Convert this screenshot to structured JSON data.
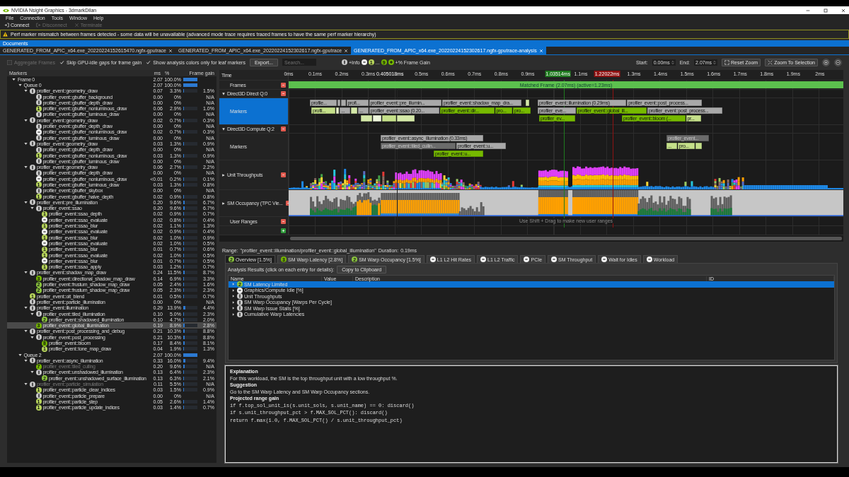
{
  "window": {
    "title": "NVIDIA Nsight Graphics - 3dmarkDilan"
  },
  "menu": [
    "File",
    "Connection",
    "Tools",
    "Window",
    "Help"
  ],
  "toolbar": [
    {
      "kind": "connect",
      "label": "Connect",
      "disabled": false
    },
    {
      "kind": "disconnect",
      "label": "Disconnect",
      "disabled": true
    },
    {
      "kind": "terminate",
      "label": "Terminate",
      "disabled": true
    }
  ],
  "warning": "Perf marker mismatch between frames detected - some data will be unavailable (advanced mode trace requires traced frames to have the same perf marker hierarchy)",
  "documents": {
    "title": "Documents",
    "tabs": [
      {
        "label": "GENERATED_FROM_APIC_x64.exe_20220224152615470.ngfx-gputrace",
        "selected": false
      },
      {
        "label": "GENERATED_FROM_APIC_x64.exe_20220224152302617.ngfx-gputrace",
        "selected": false
      },
      {
        "label": "GENERATED_FROM_APIC_x64.exe_20220224152302617.ngfx-gputrace-analysis",
        "selected": true
      }
    ]
  },
  "options": {
    "checkboxes": [
      {
        "label": "Aggregate Frames",
        "checked": false,
        "disabled": true
      },
      {
        "label": "Skip GPU-idle gaps for frame gain",
        "checked": true,
        "disabled": false
      },
      {
        "label": "Show analysis colors only for leaf markers",
        "checked": true,
        "disabled": false
      }
    ],
    "export": "Export...",
    "search": {
      "placeholder": "Search..."
    },
    "legend": [
      {
        "kind": "info"
      },
      {
        "kind": "text",
        "text": "+Info"
      },
      {
        "kind": "idle"
      },
      {
        "kind": "gain",
        "text": "1",
        "color": "#b8d65c"
      },
      {
        "kind": "text",
        "text": "..."
      },
      {
        "kind": "gain",
        "text": "9",
        "color": "#76b900"
      },
      {
        "kind": "plus"
      },
      {
        "kind": "text",
        "text": "+% Frame Gain"
      }
    ],
    "start_label": "Start:",
    "start": "0.00ms",
    "end_label": "End:",
    "end": "2.07ms",
    "buttons": [
      {
        "kind": "reset",
        "label": "Reset Zoom"
      },
      {
        "kind": "select",
        "label": "Zoom To Selection"
      },
      {
        "kind": "zoom-in"
      },
      {
        "kind": "zoom-out"
      }
    ]
  },
  "markers": {
    "columns": [
      "Markers",
      "ms",
      "%",
      "Frame gain"
    ],
    "rows": [
      {
        "name": "Frame 0",
        "ms": "2.07",
        "pct": "100.0%",
        "level": 1,
        "selected": false,
        "dimmed": false,
        "expanded": true,
        "children": [
          {
            "name": "Queue 0",
            "ms": "2.07",
            "pct": "100.0%",
            "level": 1,
            "selected": false,
            "dimmed": false,
            "expanded": true,
            "children": [
              {
                "name": "profiler_event::geometry_draw",
                "kind": "info",
                "ms": "0.07",
                "pct": "3.3%",
                "level": 0.033,
                "gain": "1.5%",
                "selected": false,
                "dimmed": false,
                "expanded": true,
                "children": [
                  {
                    "name": "profiler_event::gbuffer_background",
                    "kind": "info",
                    "ms": "0.00",
                    "pct": "0%",
                    "gain": "N/A",
                    "selected": false,
                    "dimmed": false
                  },
                  {
                    "name": "profiler_event::gbuffer_depth_draw",
                    "kind": "info",
                    "ms": "0.00",
                    "pct": "0%",
                    "gain": "N/A",
                    "selected": false,
                    "dimmed": false
                  },
                  {
                    "name": "profiler_event::gbuffer_nonluminous_draw",
                    "kind": "gain",
                    "badge": "1",
                    "color": "#b8d65c",
                    "ms": "0.06",
                    "pct": "2.9%",
                    "level": 0.029,
                    "gain": "1.0%",
                    "selected": false,
                    "dimmed": false
                  },
                  {
                    "name": "profiler_event::gbuffer_luminous_draw",
                    "kind": "info",
                    "ms": "0.00",
                    "pct": "0%",
                    "gain": "N/A",
                    "selected": false,
                    "dimmed": false
                  }
                ]
              },
              {
                "name": "profiler_event::geometry_draw",
                "kind": "info",
                "ms": "0.02",
                "pct": "0.7%",
                "level": 0.007,
                "gain": "0.3%",
                "selected": false,
                "dimmed": false,
                "expanded": true,
                "children": [
                  {
                    "name": "profiler_event::gbuffer_depth_draw",
                    "kind": "info",
                    "ms": "0.00",
                    "pct": "0%",
                    "gain": "N/A",
                    "selected": false,
                    "dimmed": false
                  },
                  {
                    "name": "profiler_event::gbuffer_nonluminous_draw",
                    "kind": "idle",
                    "ms": "0.02",
                    "pct": "0.7%",
                    "level": 0.007,
                    "gain": "0.3%",
                    "selected": false,
                    "dimmed": false
                  },
                  {
                    "name": "profiler_event::gbuffer_luminous_draw",
                    "kind": "info",
                    "ms": "0.00",
                    "pct": "0%",
                    "gain": "N/A",
                    "selected": false,
                    "dimmed": false
                  }
                ]
              },
              {
                "name": "profiler_event::geometry_draw",
                "kind": "info",
                "ms": "0.03",
                "pct": "1.3%",
                "level": 0.013,
                "gain": "0.9%",
                "selected": false,
                "dimmed": false,
                "expanded": true,
                "children": [
                  {
                    "name": "profiler_event::gbuffer_depth_draw",
                    "kind": "info",
                    "ms": "0.00",
                    "pct": "0%",
                    "gain": "N/A",
                    "selected": false,
                    "dimmed": false
                  },
                  {
                    "name": "profiler_event::gbuffer_nonluminous_draw",
                    "kind": "gain",
                    "badge": "1",
                    "color": "#b8d65c",
                    "ms": "0.03",
                    "pct": "1.3%",
                    "level": 0.013,
                    "gain": "0.9%",
                    "selected": false,
                    "dimmed": false
                  },
                  {
                    "name": "profiler_event::gbuffer_luminous_draw",
                    "kind": "info",
                    "ms": "0.00",
                    "pct": "0%",
                    "gain": "N/A",
                    "selected": false,
                    "dimmed": false
                  }
                ]
              },
              {
                "name": "profiler_event::geometry_draw",
                "kind": "info",
                "ms": "0.06",
                "pct": "2.7%",
                "level": 0.027,
                "gain": "2.2%",
                "selected": false,
                "dimmed": false,
                "expanded": true,
                "children": [
                  {
                    "name": "profiler_event::gbuffer_depth_draw",
                    "kind": "info",
                    "ms": "0.00",
                    "pct": "0%",
                    "gain": "N/A",
                    "selected": false,
                    "dimmed": false
                  },
                  {
                    "name": "profiler_event::gbuffer_nonluminous_draw",
                    "kind": "idle",
                    "ms": "<0.01",
                    "pct": "0.2%",
                    "level": 0.002,
                    "gain": "0.1%",
                    "selected": false,
                    "dimmed": false
                  },
                  {
                    "name": "profiler_event::gbuffer_luminous_draw",
                    "kind": "gain",
                    "badge": "1",
                    "color": "#b8d65c",
                    "ms": "0.03",
                    "pct": "1.3%",
                    "level": 0.013,
                    "gain": "0.8%",
                    "selected": false,
                    "dimmed": false
                  },
                  {
                    "name": "profiler_event::gbuffer_skybox",
                    "kind": "info",
                    "ms": "0.00",
                    "pct": "0%",
                    "gain": "N/A",
                    "selected": false,
                    "dimmed": false
                  },
                  {
                    "name": "profiler_event::gbuffer_halve_depth",
                    "kind": "gain",
                    "badge": "1",
                    "color": "#b8d65c",
                    "ms": "0.02",
                    "pct": "0.9%",
                    "level": 0.009,
                    "gain": "0.8%",
                    "selected": false,
                    "dimmed": false
                  }
                ]
              },
              {
                "name": "profiler_event::pre_illumination",
                "kind": "info",
                "ms": "0.20",
                "pct": "9.6%",
                "level": 0.096,
                "gain": "6.7%",
                "selected": false,
                "dimmed": false,
                "expanded": true,
                "children": [
                  {
                    "name": "profiler_event::ssao",
                    "kind": "info",
                    "ms": "0.20",
                    "pct": "9.6%",
                    "level": 0.096,
                    "gain": "6.7%",
                    "selected": false,
                    "dimmed": false,
                    "expanded": true,
                    "children": [
                      {
                        "name": "profiler_event::ssao_depth",
                        "kind": "gain",
                        "badge": "1",
                        "color": "#b8d65c",
                        "ms": "0.02",
                        "pct": "0.9%",
                        "level": 0.009,
                        "gain": "0.7%",
                        "selected": false,
                        "dimmed": false
                      },
                      {
                        "name": "profiler_event::ssao_evaluate",
                        "kind": "idle",
                        "ms": "0.02",
                        "pct": "0.8%",
                        "level": 0.008,
                        "gain": "0.4%",
                        "selected": false,
                        "dimmed": false
                      },
                      {
                        "name": "profiler_event::ssao_blur",
                        "kind": "gain",
                        "badge": "1",
                        "color": "#b8d65c",
                        "ms": "0.02",
                        "pct": "1.1%",
                        "level": 0.011,
                        "gain": "1.3%",
                        "selected": false,
                        "dimmed": false
                      },
                      {
                        "name": "profiler_event::ssao_evaluate",
                        "kind": "idle",
                        "ms": "0.02",
                        "pct": "0.9%",
                        "level": 0.009,
                        "gain": "0.4%",
                        "selected": false,
                        "dimmed": false
                      },
                      {
                        "name": "profiler_event::ssao_blur",
                        "kind": "gain",
                        "badge": "1",
                        "color": "#b8d65c",
                        "ms": "0.02",
                        "pct": "1.0%",
                        "level": 0.01,
                        "gain": "0.9%",
                        "selected": false,
                        "dimmed": false
                      },
                      {
                        "name": "profiler_event::ssao_evaluate",
                        "kind": "idle",
                        "ms": "0.02",
                        "pct": "1.0%",
                        "level": 0.01,
                        "gain": "0.5%",
                        "selected": false,
                        "dimmed": false
                      },
                      {
                        "name": "profiler_event::ssao_blur",
                        "kind": "gain",
                        "badge": "1",
                        "color": "#b8d65c",
                        "ms": "0.01",
                        "pct": "0.7%",
                        "level": 0.007,
                        "gain": "0.6%",
                        "selected": false,
                        "dimmed": false
                      },
                      {
                        "name": "profiler_event::ssao_evaluate",
                        "kind": "gain",
                        "badge": "1",
                        "color": "#b8d65c",
                        "ms": "0.02",
                        "pct": "1.0%",
                        "level": 0.01,
                        "gain": "0.5%",
                        "selected": false,
                        "dimmed": false
                      },
                      {
                        "name": "profiler_event::ssao_blur",
                        "kind": "idle",
                        "ms": "0.01",
                        "pct": "0.7%",
                        "level": 0.007,
                        "gain": "0.5%",
                        "selected": false,
                        "dimmed": false
                      },
                      {
                        "name": "profiler_event::ssao_apply",
                        "kind": "gain",
                        "badge": "1",
                        "color": "#b8d65c",
                        "ms": "0.03",
                        "pct": "1.2%",
                        "level": 0.012,
                        "gain": "0.7%",
                        "selected": false,
                        "dimmed": false
                      }
                    ]
                  }
                ]
              },
              {
                "name": "profiler_event::shadow_map_draw",
                "kind": "info",
                "ms": "0.24",
                "pct": "11.5%",
                "level": 0.115,
                "gain": "8.7%",
                "selected": false,
                "dimmed": false,
                "expanded": true,
                "children": [
                  {
                    "name": "profiler_event::directional_shadow_map_draw",
                    "kind": "gain",
                    "badge": "3",
                    "color": "#76b900",
                    "ms": "0.14",
                    "pct": "6.9%",
                    "level": 0.069,
                    "gain": "3.3%",
                    "selected": false,
                    "dimmed": false
                  },
                  {
                    "name": "profiler_event::frustum_shadow_map_draw",
                    "kind": "gain",
                    "badge": "2",
                    "color": "#8cc63f",
                    "ms": "0.05",
                    "pct": "2.4%",
                    "level": 0.024,
                    "gain": "1.6%",
                    "selected": false,
                    "dimmed": false
                  },
                  {
                    "name": "profiler_event::frustum_shadow_map_draw",
                    "kind": "gain",
                    "badge": "2",
                    "color": "#8cc63f",
                    "ms": "0.05",
                    "pct": "2.3%",
                    "level": 0.023,
                    "gain": "2.3%",
                    "selected": false,
                    "dimmed": false
                  }
                ]
              },
              {
                "name": "profiler_event::oit_blend",
                "kind": "gain",
                "badge": "1",
                "color": "#b8d65c",
                "ms": "0.01",
                "pct": "0.5%",
                "level": 0.005,
                "gain": "0.7%",
                "selected": false,
                "dimmed": false
              },
              {
                "name": "profiler_event::particle_illumination",
                "kind": "info",
                "ms": "0.00",
                "pct": "0%",
                "gain": "N/A",
                "selected": false,
                "dimmed": false
              },
              {
                "name": "profiler_event::illumination",
                "kind": "info",
                "ms": "0.29",
                "pct": "13.9%",
                "level": 0.139,
                "gain": "4.4%",
                "selected": false,
                "dimmed": false,
                "expanded": true,
                "children": [
                  {
                    "name": "profiler_event::tiled_illumination",
                    "kind": "info",
                    "ms": "0.10",
                    "pct": "5.0%",
                    "level": 0.05,
                    "gain": "2.3%",
                    "selected": false,
                    "dimmed": false,
                    "expanded": true,
                    "children": [
                      {
                        "name": "profiler_event::shadowed_illumination",
                        "kind": "gain",
                        "badge": "2",
                        "color": "#8cc63f",
                        "ms": "0.10",
                        "pct": "4.7%",
                        "level": 0.047,
                        "gain": "2.0%",
                        "selected": false,
                        "dimmed": false
                      }
                    ]
                  },
                  {
                    "name": "profiler_event::global_illumination",
                    "kind": "gain",
                    "badge": "3",
                    "color": "#76b900",
                    "ms": "0.19",
                    "pct": "8.9%",
                    "level": 0.089,
                    "gain": "2.8%",
                    "selected": true,
                    "dimmed": false
                  }
                ]
              },
              {
                "name": "profiler_event::post_processing_and_debug",
                "kind": "info",
                "ms": "0.21",
                "pct": "10.3%",
                "level": 0.103,
                "gain": "8.8%",
                "selected": false,
                "dimmed": false,
                "expanded": true,
                "children": [
                  {
                    "name": "profiler_event::post_processing",
                    "kind": "info",
                    "ms": "0.21",
                    "pct": "10.3%",
                    "level": 0.103,
                    "gain": "8.8%",
                    "selected": false,
                    "dimmed": false,
                    "expanded": true,
                    "children": [
                      {
                        "name": "profiler_event::bloom",
                        "kind": "gain",
                        "badge": "8",
                        "color": "#76b900",
                        "ms": "0.17",
                        "pct": "8.4%",
                        "level": 0.084,
                        "gain": "8.1%",
                        "selected": false,
                        "dimmed": false
                      },
                      {
                        "name": "profiler_event::tone_map_draw",
                        "kind": "gain",
                        "badge": "1",
                        "color": "#b8d65c",
                        "ms": "0.04",
                        "pct": "1.9%",
                        "level": 0.019,
                        "gain": "1.3%",
                        "selected": false,
                        "dimmed": false
                      }
                    ]
                  }
                ]
              }
            ]
          },
          {
            "name": "Queue 2",
            "ms": "2.07",
            "pct": "100.0%",
            "level": 1,
            "selected": false,
            "dimmed": false,
            "expanded": true,
            "children": [
              {
                "name": "profiler_event::async_illumination",
                "kind": "info",
                "ms": "0.33",
                "pct": "16.0%",
                "level": 0.16,
                "gain": "9.4%",
                "selected": false,
                "dimmed": false,
                "expanded": true,
                "children": [
                  {
                    "name": "profiler_event::tiled_culling",
                    "kind": "gain",
                    "badge": "7",
                    "color": "#76b900",
                    "ms": "0.20",
                    "pct": "9.6%",
                    "level": 0.096,
                    "gain": "N/A",
                    "selected": false,
                    "dimmed": true
                  },
                  {
                    "name": "profiler_event::unshadowed_illumination",
                    "kind": "info",
                    "ms": "0.13",
                    "pct": "6.4%",
                    "level": 0.064,
                    "gain": "2.3%",
                    "selected": false,
                    "dimmed": false,
                    "expanded": true,
                    "children": [
                      {
                        "name": "profiler_event::unshadowed_surface_illumination",
                        "kind": "gain",
                        "badge": "2",
                        "color": "#8cc63f",
                        "ms": "0.13",
                        "pct": "6.3%",
                        "level": 0.063,
                        "gain": "2.1%",
                        "selected": false,
                        "dimmed": false
                      }
                    ]
                  }
                ]
              },
              {
                "name": "profiler_event::particle_simulation",
                "kind": "info",
                "ms": "0.11",
                "pct": "5.5%",
                "level": 0.055,
                "gain": "N/A",
                "selected": false,
                "dimmed": true,
                "expanded": true,
                "children": [
                  {
                    "name": "profiler_event::particle_clear_indices",
                    "kind": "gain",
                    "badge": "1",
                    "color": "#b8d65c",
                    "ms": "0.03",
                    "pct": "1.5%",
                    "level": 0.015,
                    "gain": "0.9%",
                    "selected": false,
                    "dimmed": false
                  },
                  {
                    "name": "profiler_event::particle_prepare",
                    "kind": "info",
                    "ms": "0.00",
                    "pct": "0%",
                    "gain": "N/A",
                    "selected": false,
                    "dimmed": false
                  },
                  {
                    "name": "profiler_event::particle_step",
                    "kind": "gain",
                    "badge": "1",
                    "color": "#b8d65c",
                    "ms": "0.05",
                    "pct": "2.6%",
                    "level": 0.026,
                    "gain": "1.4%",
                    "selected": false,
                    "dimmed": false
                  },
                  {
                    "name": "profiler_event::particle_update_indices",
                    "kind": "gain",
                    "badge": "1",
                    "color": "#b8d65c",
                    "ms": "0.03",
                    "pct": "1.4%",
                    "level": 0.014,
                    "gain": "0.7%",
                    "selected": false,
                    "dimmed": false
                  }
                ]
              }
            ]
          }
        ]
      }
    ]
  },
  "timeline": {
    "time_label": "Time",
    "ticks": [
      "0ms",
      "0.1ms",
      "0.2ms",
      "0.3ms",
      "0.5ms",
      "0.6ms",
      "0.7ms",
      "0.8ms",
      "0.9ms",
      "1.1ms",
      "1.3ms",
      "1.4ms",
      "1.5ms",
      "1.6ms",
      "1.7ms",
      "1.8ms",
      "1.9ms",
      "2ms"
    ],
    "cursors": [
      {
        "label": "0.405018ms",
        "color": "#222222"
      },
      {
        "label": "1.03514ms",
        "color": "#1f7a1f"
      },
      {
        "label": "1.22022ms",
        "color": "#8e1212"
      }
    ],
    "lanes": [
      {
        "kind": "frames",
        "label": "Frames",
        "bar": "Matched Frame (2.07ms) (active=1.23ms)"
      },
      {
        "kind": "queue",
        "label": "Direct3D Direct Q:0",
        "expanded": true
      },
      {
        "kind": "markers",
        "label": "Markers",
        "selected": true,
        "blocks": [
          {
            "label": "profile...",
            "color": "#a9a9a9"
          },
          {
            "color": "#a9a9a9"
          },
          {
            "color": "#a9a9a9"
          },
          {
            "label": "profi...",
            "color": "#a9a9a9"
          },
          {
            "label": "profiler_event::pre_illumin...",
            "color": "#a9a9a9"
          },
          {
            "label": "profiler_event::shadow_map_dra...",
            "color": "#a9a9a9"
          },
          {
            "color": "#d4e8a8"
          },
          {
            "label": "profiler_event::illumination (0.29ms)",
            "color": "#a9a9a9"
          },
          {
            "label": "profiler_event::post_process...",
            "color": "#a9a9a9"
          },
          {
            "label": "profil...",
            "color": "#c5e08a"
          },
          {
            "color": "#e6f2cc"
          },
          {
            "label": "...",
            "color": "#a9a9a9"
          },
          {
            "color": "#d4e8a8"
          },
          {
            "label": "...",
            "color": "#a9a9a9"
          },
          {
            "label": "profiler_event::ssao (0.20...",
            "color": "#a9a9a9"
          },
          {
            "label": "profiler_event::dir...",
            "color": "#76b900"
          },
          {
            "label": "pro...",
            "color": "#76b900"
          },
          {
            "label": "pro...",
            "color": "#76b900"
          },
          {
            "label": "profiler_eve...",
            "color": "#a9a9a9"
          },
          {
            "label": "profiler_event::global_ill...",
            "color": "#76b900"
          },
          {
            "label": "profiler_event::post_process...",
            "color": "#a9a9a9"
          },
          {
            "color": "#d4e8a8"
          },
          {
            "color": "#eef6dc"
          },
          {
            "color": "#c5e08a"
          },
          {
            "color": "#d4e8a8"
          },
          {
            "label": "profiler_ev...",
            "color": "#76b900"
          },
          {
            "label": "profiler_event::bloom (...",
            "color": "#76b900"
          },
          {
            "label": "pr...",
            "color": "#c5e08a"
          }
        ]
      },
      {
        "kind": "queue",
        "label": "Direct3D Compute Q:2",
        "expanded": true
      },
      {
        "kind": "markers",
        "label": "Markers",
        "selected": false,
        "blocks": [
          {
            "label": "profiler_event::async_illumination (0.33ms)",
            "color": "#a9a9a9"
          },
          {
            "label": "profiler_event...",
            "color": "#6b6b6b"
          },
          {
            "label": "profiler_event::tiled_cullin...",
            "color": "#6b6b6b"
          },
          {
            "label": "profiler_event::u...",
            "color": "#a9a9a9"
          },
          {
            "label": "...",
            "color": "#c5e08a"
          },
          {
            "label": "pro...",
            "color": "#c5e08a"
          },
          {
            "color": "#c5e08a"
          },
          {
            "label": "profiler_event::u...",
            "color": "#76b900"
          }
        ]
      },
      {
        "kind": "throughput",
        "label": "Unit Throughputs",
        "expanded": false
      },
      {
        "kind": "occupancy",
        "label": "SM Occupancy (TPC Vie...",
        "expanded": false
      },
      {
        "kind": "ranges",
        "label": "User Ranges",
        "hint": "Use Shift + Drag to make new user ranges"
      }
    ]
  },
  "range": {
    "label": "Range:",
    "value": "\"profiler_event::illumination/profiler_event::global_illumination\"",
    "duration_label": "Duration:",
    "duration": "0.19ms"
  },
  "analysis": {
    "tabs": [
      {
        "label": "Overview [1.5%]",
        "kind": "gain",
        "badge": "2",
        "color": "#8cc63f",
        "selected": true
      },
      {
        "label": "SM Warp Latency [2.8%]",
        "kind": "gain",
        "badge": "3",
        "color": "#76b900",
        "selected": false
      },
      {
        "label": "SM Warp Occupancy [1.5%]",
        "kind": "gain",
        "badge": "2",
        "color": "#8cc63f",
        "selected": false
      },
      {
        "label": "L1 L2 Hit Rates",
        "kind": "idle",
        "selected": false
      },
      {
        "label": "L1 L2 Traffic",
        "kind": "idle",
        "selected": false
      },
      {
        "label": "PCIe",
        "kind": "idle",
        "selected": false
      },
      {
        "label": "SM Throughput",
        "kind": "idle",
        "selected": false
      },
      {
        "label": "Wait for Idles",
        "kind": "idle",
        "selected": false
      },
      {
        "label": "Workload",
        "kind": "idle",
        "selected": false
      }
    ],
    "results_label": "Analysis Results (click on each entry for details):",
    "copy_button": "Copy to Clipboard",
    "columns": [
      "Name",
      "Value",
      "Description",
      "ID"
    ],
    "rows": [
      {
        "name": "SM Latency Limited",
        "kind": "gain",
        "badge": "2",
        "color": "#8cc63f",
        "selected": true,
        "expanded": false
      },
      {
        "name": "Graphics/Compute Idle [%]",
        "kind": "idle",
        "selected": false,
        "expanded": false
      },
      {
        "name": "Unit Throughputs",
        "kind": "info",
        "selected": false,
        "expanded": false
      },
      {
        "name": "SM Warp Occupancy [Warps Per Cycle]",
        "kind": "info",
        "selected": false,
        "expanded": false
      },
      {
        "name": "SM Warp Issue Stalls [%]",
        "kind": "info",
        "selected": false,
        "expanded": false
      },
      {
        "name": "Cumulative Warp Latencies",
        "kind": "info",
        "selected": false,
        "expanded": false
      }
    ],
    "details": [
      {
        "kind": "heading",
        "text": "Explanation"
      },
      {
        "kind": "text",
        "text": "For this workload, the SM is the top throughput unit with a low throughput %."
      },
      {
        "kind": "heading",
        "text": "Suggestion"
      },
      {
        "kind": "text",
        "text": "Go to the SM Warp Latency and SM Warp Occupancy sections."
      },
      {
        "kind": "heading",
        "text": "Projected range gain"
      },
      {
        "kind": "code",
        "text": "if f.top_sol_unit_is(s.unit_sols, s.unit_name) == 0: discard()"
      },
      {
        "kind": "code",
        "text": "if s.unit_throughput_pct > f.MAX_SOL_PCT(): discard()"
      },
      {
        "kind": "code",
        "text": "return f.max(1.0, f.MAX_SOL_PCT() / s.unit_throughput_pct)"
      }
    ]
  }
}
